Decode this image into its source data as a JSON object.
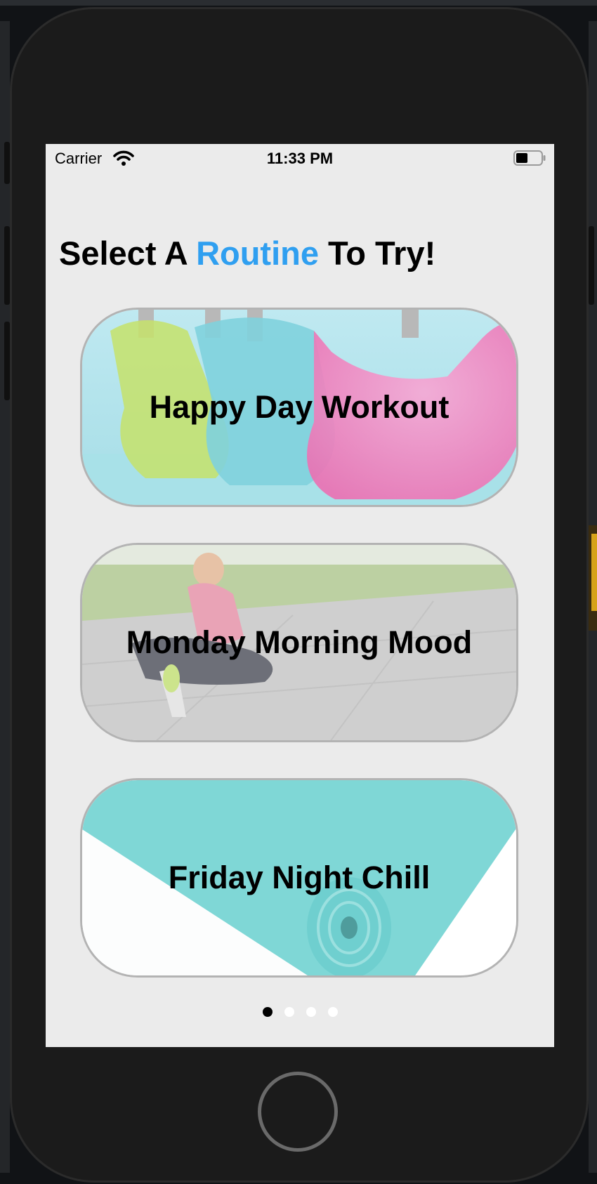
{
  "status_bar": {
    "carrier": "Carrier",
    "time": "11:33 PM",
    "wifi_icon": "wifi-icon",
    "battery_icon": "battery-icon"
  },
  "header": {
    "prefix": "Select A",
    "highlight": "Routine",
    "suffix": "To Try!",
    "highlight_color": "#2f9ff0"
  },
  "routines": [
    {
      "label": "Happy Day Workout",
      "image": "kettlebells-photo"
    },
    {
      "label": "Monday Morning Mood",
      "image": "stretching-woman-photo"
    },
    {
      "label": "Friday Night Chill",
      "image": "yoga-mat-photo"
    }
  ],
  "pager": {
    "total": 4,
    "current": 1
  },
  "colors": {
    "screen_background": "#ebebeb",
    "card_border": "#b3b3b3",
    "device_frame": "#1b1b1b"
  }
}
